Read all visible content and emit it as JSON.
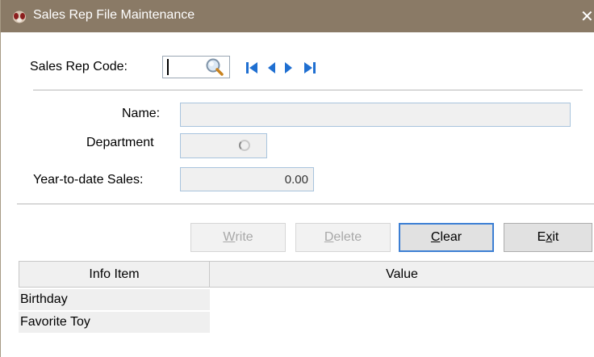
{
  "window": {
    "title": "Sales Rep File Maintenance",
    "close_glyph": "✕",
    "titlebar_color": "#8a7a66"
  },
  "header": {
    "code_label": "Sales Rep Code:",
    "code_value": "",
    "icons": [
      "search-icon",
      "first-record-icon",
      "previous-record-icon",
      "next-record-icon",
      "last-record-icon"
    ],
    "accent_color": "#1f6fd1"
  },
  "form": {
    "name_label": "Name:",
    "name_value": "",
    "department_label": "Department",
    "department_value": "",
    "ytd_label": "Year-to-date Sales:",
    "ytd_value": "0.00"
  },
  "buttons": {
    "write": {
      "label": "Write",
      "mnemonic": "W",
      "rest": "rite",
      "enabled": false
    },
    "delete": {
      "label": "Delete",
      "mnemonic": "D",
      "rest": "elete",
      "enabled": false
    },
    "clear": {
      "label": "Clear",
      "mnemonic": "C",
      "rest": "lear",
      "enabled": true
    },
    "exit": {
      "label": "Exit",
      "pre": "E",
      "mnemonic": "x",
      "rest": "it",
      "enabled": true
    }
  },
  "grid": {
    "columns": [
      "Info Item",
      "Value"
    ],
    "rows": [
      {
        "item": "Birthday",
        "value": ""
      },
      {
        "item": "Favorite Toy",
        "value": ""
      }
    ]
  }
}
